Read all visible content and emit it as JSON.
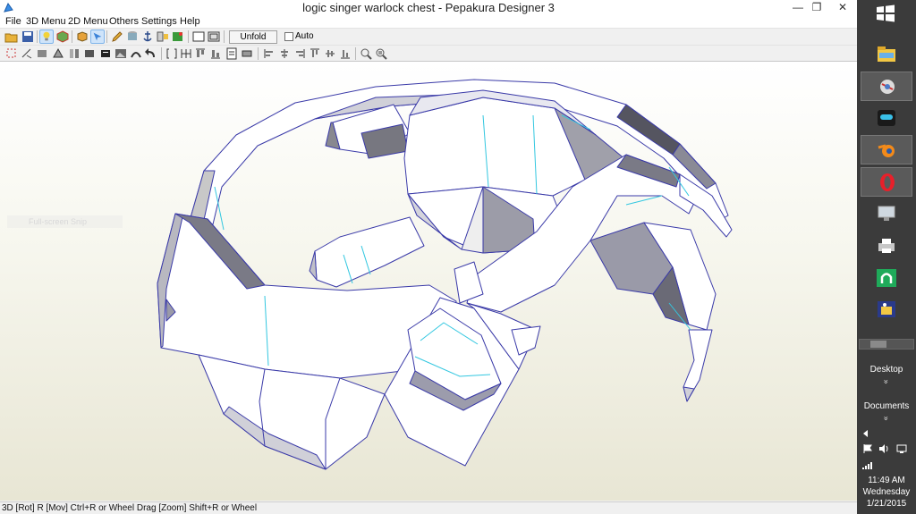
{
  "window": {
    "title": "logic singer warlock chest - Pepakura Designer 3",
    "min_glyph": "—",
    "restore_glyph": "❐",
    "close_glyph": "✕"
  },
  "menu": [
    "File",
    "3D Menu",
    "2D Menu",
    "Others",
    "Settings",
    "Help"
  ],
  "toolbar": {
    "unfold_label": "Unfold",
    "auto_label": "Auto",
    "auto_checked": false
  },
  "viewport": {
    "snip_label": "Full-screen Snip"
  },
  "status": {
    "text": "3D [Rot] R [Mov] Ctrl+R or Wheel Drag [Zoom] Shift+R or Wheel"
  },
  "taskbar": {
    "desktop_label": "Desktop",
    "documents_label": "Documents",
    "chevron": "»",
    "time": "11:49 AM",
    "day": "Wednesday",
    "date": "1/21/2015",
    "apps": [
      "file-explorer-icon",
      "settings-app-icon",
      "media-app-icon",
      "blender-icon",
      "opera-icon",
      "monitor-app-icon",
      "printer-icon",
      "green-app-icon",
      "paint-app-icon"
    ]
  },
  "colors": {
    "accent": "#cfe4fa",
    "model_edge": "#3a3aa8",
    "fold_line": "#33c7e0",
    "taskbar": "#3b3b3b"
  }
}
